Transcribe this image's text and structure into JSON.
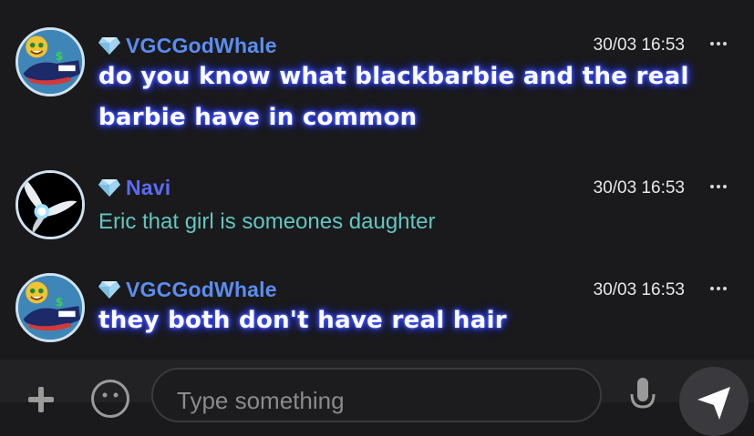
{
  "messages": [
    {
      "username": "VGCGodWhale",
      "username_color": "#5b8df0",
      "timestamp": "30/03 16:53",
      "text": "do you know what blackbarbie and the real barbie have in common",
      "style": "glow",
      "avatar": "money-whale-avatar"
    },
    {
      "username": "Navi",
      "username_color": "#5b6cf0",
      "timestamp": "30/03 16:53",
      "text": "Eric that girl is someones daughter",
      "style": "teal",
      "avatar": "fairy-avatar"
    },
    {
      "username": "VGCGodWhale",
      "username_color": "#5b8df0",
      "timestamp": "30/03 16:53",
      "text": "they both don't have real hair",
      "style": "glow",
      "avatar": "money-whale-avatar"
    }
  ],
  "composer": {
    "placeholder": "Type something"
  },
  "colors": {
    "background": "#1a1a1c",
    "glow": "#3347ff",
    "teal_text": "#63c5c0",
    "gem": "#9fd3f0"
  },
  "icons": [
    "diamond-icon",
    "more-icon",
    "plus-icon",
    "emoji-icon",
    "mic-icon",
    "send-icon"
  ]
}
